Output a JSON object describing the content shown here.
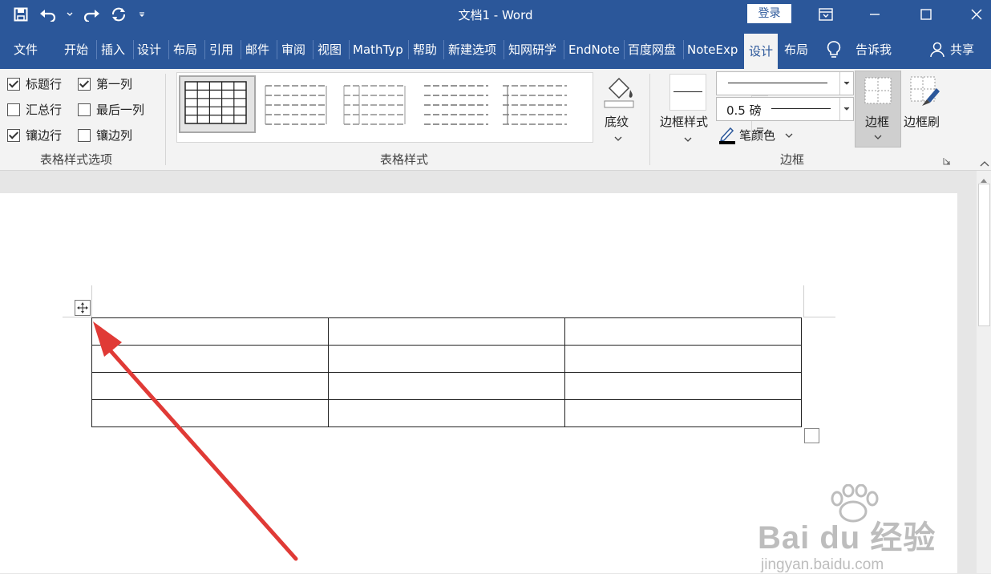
{
  "window": {
    "title": "文档1  -  Word",
    "login_label": "登录"
  },
  "tabs": [
    {
      "label": "文件",
      "active": false
    },
    {
      "label": "开始",
      "active": false
    },
    {
      "label": "插入",
      "active": false
    },
    {
      "label": "设计",
      "active": false
    },
    {
      "label": "布局",
      "active": false
    },
    {
      "label": "引用",
      "active": false
    },
    {
      "label": "邮件",
      "active": false
    },
    {
      "label": "审阅",
      "active": false
    },
    {
      "label": "视图",
      "active": false
    },
    {
      "label": "MathTyp",
      "active": false
    },
    {
      "label": "帮助",
      "active": false
    },
    {
      "label": "新建选项",
      "active": false
    },
    {
      "label": "知网研学",
      "active": false
    },
    {
      "label": "EndNote",
      "active": false
    },
    {
      "label": "百度网盘",
      "active": false
    },
    {
      "label": "NoteExp",
      "active": false
    },
    {
      "label": "设计",
      "active": true
    },
    {
      "label": "布局",
      "active": false
    }
  ],
  "tell_me": "告诉我",
  "share": "共享",
  "style_options": {
    "label": "表格样式选项",
    "items": [
      {
        "label": "标题行",
        "checked": true
      },
      {
        "label": "第一列",
        "checked": true
      },
      {
        "label": "汇总行",
        "checked": false
      },
      {
        "label": "最后一列",
        "checked": false
      },
      {
        "label": "镶边行",
        "checked": true
      },
      {
        "label": "镶边列",
        "checked": false
      }
    ]
  },
  "table_styles": {
    "label": "表格样式",
    "shading_label": "底纹"
  },
  "borders": {
    "label": "边框",
    "border_styles_label": "边框样式",
    "weight_value": "0.5 磅",
    "pen_color_label": "笔颜色",
    "borders_label": "边框",
    "border_painter_label": "边框刷"
  },
  "document": {
    "table": {
      "rows": 4,
      "columns": 3
    }
  },
  "watermark": {
    "brand": "Bai du 经验",
    "url": "jingyan.baidu.com"
  },
  "colors": {
    "title_bar": "#2b579a",
    "ribbon": "#f3f3f3",
    "arrow": "#e03a36"
  }
}
